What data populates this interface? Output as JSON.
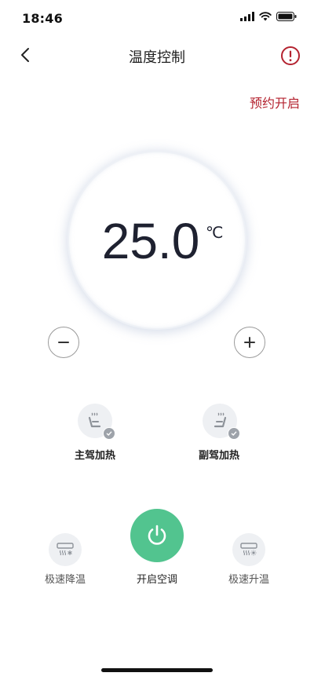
{
  "status_bar": {
    "time": "18:46"
  },
  "nav": {
    "title": "温度控制"
  },
  "schedule": {
    "label": "预约开启"
  },
  "temperature": {
    "value": "25.0",
    "unit": "℃"
  },
  "seat_heating": {
    "driver_label": "主驾加热",
    "passenger_label": "副驾加热"
  },
  "controls": {
    "quick_cool_label": "极速降温",
    "power_label": "开启空调",
    "quick_heat_label": "极速升温"
  },
  "colors": {
    "accent_red": "#b4222f",
    "power_green": "#52c48f",
    "icon_bg": "#eef0f3"
  },
  "icons": [
    "back-icon",
    "info-icon",
    "minus-icon",
    "plus-icon",
    "seat-heat-icon",
    "check-icon",
    "power-icon",
    "ac-cool-icon",
    "ac-heat-icon"
  ]
}
